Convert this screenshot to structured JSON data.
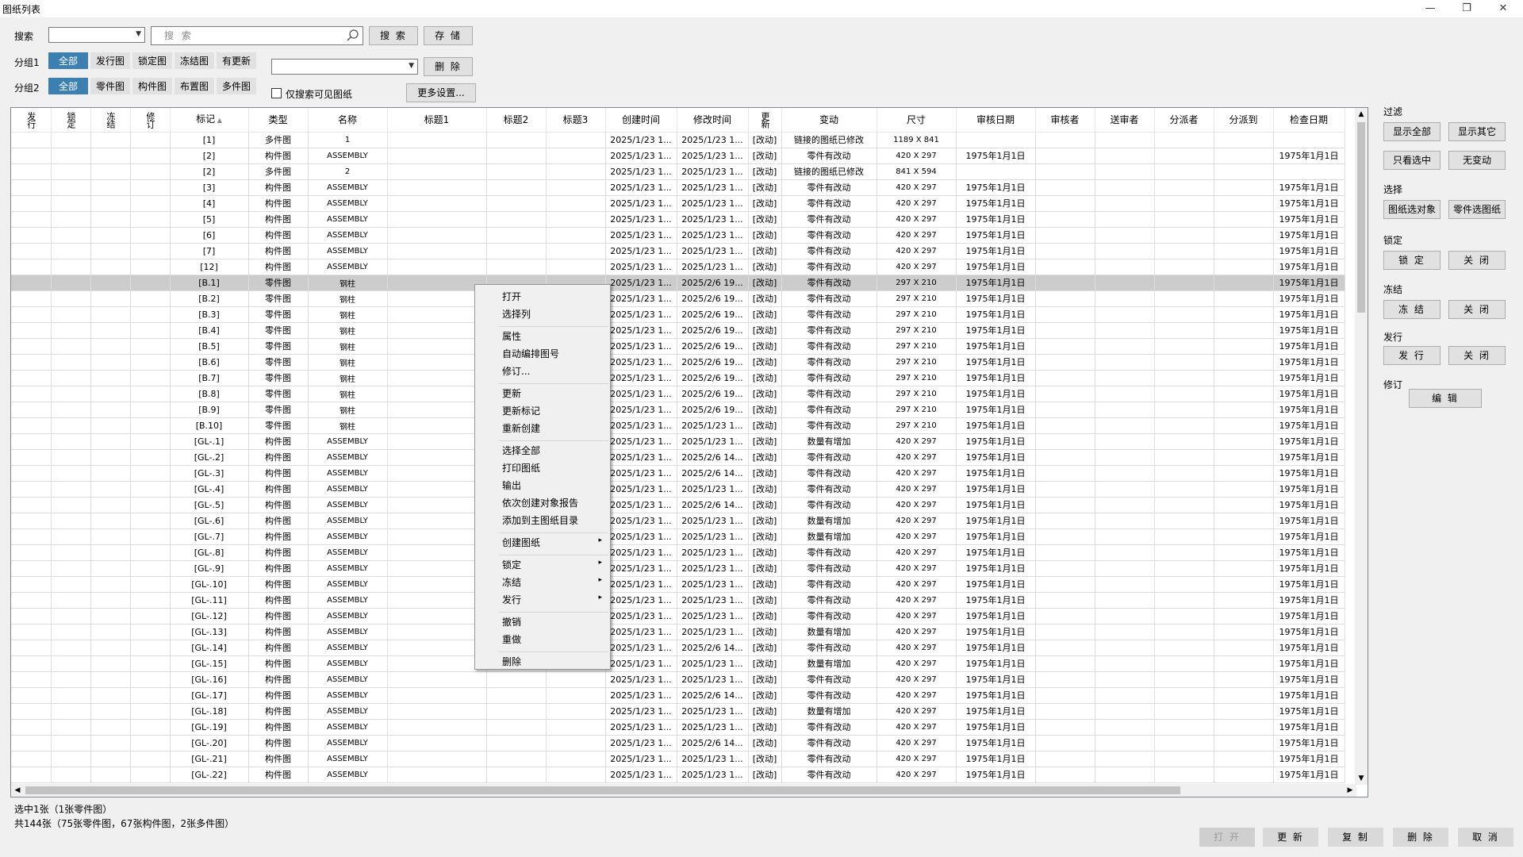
{
  "window": {
    "title": "图纸列表",
    "min": "—",
    "max": "❐",
    "close": "✕"
  },
  "toolbar": {
    "search_label": "搜索",
    "search_placeholder": "搜 索",
    "search_btn": "搜 索",
    "save_btn": "存 储",
    "group1_label": "分组1",
    "group2_label": "分组2",
    "group1": [
      "全部",
      "发行图",
      "锁定图",
      "冻结图",
      "有更新"
    ],
    "group2": [
      "全部",
      "零件图",
      "构件图",
      "布置图",
      "多件图"
    ],
    "delete_btn": "删 除",
    "only_visible": "仅搜索可见图纸",
    "more_btn": "更多设置..."
  },
  "columns": [
    "发行",
    "锁定",
    "冻结",
    "修订",
    "标记",
    "类型",
    "名称",
    "标题1",
    "标题2",
    "标题3",
    "创建时间",
    "修改时间",
    "更新",
    "变动",
    "尺寸",
    "审核日期",
    "审核者",
    "送审者",
    "分派者",
    "分派到",
    "检查日期"
  ],
  "rows": [
    [
      "[1]",
      "多件图",
      "1",
      "2025/1/23 1...",
      "2025/1/23 1...",
      "[改动]",
      "链接的图纸已修改",
      "1189 X 841",
      "",
      ""
    ],
    [
      "[2]",
      "构件图",
      "ASSEMBLY",
      "2025/1/23 1...",
      "2025/1/23 1...",
      "[改动]",
      "零件有改动",
      "420 X 297",
      "1975年1月1日",
      "1975年1月1日"
    ],
    [
      "[2]",
      "多件图",
      "2",
      "2025/1/23 1...",
      "2025/1/23 1...",
      "[改动]",
      "链接的图纸已修改",
      "841 X 594",
      "",
      ""
    ],
    [
      "[3]",
      "构件图",
      "ASSEMBLY",
      "2025/1/23 1...",
      "2025/1/23 1...",
      "[改动]",
      "零件有改动",
      "420 X 297",
      "1975年1月1日",
      "1975年1月1日"
    ],
    [
      "[4]",
      "构件图",
      "ASSEMBLY",
      "2025/1/23 1...",
      "2025/1/23 1...",
      "[改动]",
      "零件有改动",
      "420 X 297",
      "1975年1月1日",
      "1975年1月1日"
    ],
    [
      "[5]",
      "构件图",
      "ASSEMBLY",
      "2025/1/23 1...",
      "2025/1/23 1...",
      "[改动]",
      "零件有改动",
      "420 X 297",
      "1975年1月1日",
      "1975年1月1日"
    ],
    [
      "[6]",
      "构件图",
      "ASSEMBLY",
      "2025/1/23 1...",
      "2025/1/23 1...",
      "[改动]",
      "零件有改动",
      "420 X 297",
      "1975年1月1日",
      "1975年1月1日"
    ],
    [
      "[7]",
      "构件图",
      "ASSEMBLY",
      "2025/1/23 1...",
      "2025/1/23 1...",
      "[改动]",
      "零件有改动",
      "420 X 297",
      "1975年1月1日",
      "1975年1月1日"
    ],
    [
      "[12]",
      "构件图",
      "ASSEMBLY",
      "2025/1/23 1...",
      "2025/1/23 1...",
      "[改动]",
      "零件有改动",
      "420 X 297",
      "1975年1月1日",
      "1975年1月1日"
    ],
    [
      "[B.1]",
      "零件图",
      "钢柱",
      "2025/1/23 1...",
      "2025/2/6 19...",
      "[改动]",
      "零件有改动",
      "297 X 210",
      "1975年1月1日",
      "1975年1月1日"
    ],
    [
      "[B.2]",
      "零件图",
      "钢柱",
      "2025/1/23 1...",
      "2025/2/6 19...",
      "[改动]",
      "零件有改动",
      "297 X 210",
      "1975年1月1日",
      "1975年1月1日"
    ],
    [
      "[B.3]",
      "零件图",
      "钢柱",
      "2025/1/23 1...",
      "2025/2/6 19...",
      "[改动]",
      "零件有改动",
      "297 X 210",
      "1975年1月1日",
      "1975年1月1日"
    ],
    [
      "[B.4]",
      "零件图",
      "钢柱",
      "2025/1/23 1...",
      "2025/2/6 19...",
      "[改动]",
      "零件有改动",
      "297 X 210",
      "1975年1月1日",
      "1975年1月1日"
    ],
    [
      "[B.5]",
      "零件图",
      "钢柱",
      "2025/1/23 1...",
      "2025/2/6 19...",
      "[改动]",
      "零件有改动",
      "297 X 210",
      "1975年1月1日",
      "1975年1月1日"
    ],
    [
      "[B.6]",
      "零件图",
      "钢柱",
      "2025/1/23 1...",
      "2025/2/6 19...",
      "[改动]",
      "零件有改动",
      "297 X 210",
      "1975年1月1日",
      "1975年1月1日"
    ],
    [
      "[B.7]",
      "零件图",
      "钢柱",
      "2025/1/23 1...",
      "2025/2/6 19...",
      "[改动]",
      "零件有改动",
      "297 X 210",
      "1975年1月1日",
      "1975年1月1日"
    ],
    [
      "[B.8]",
      "零件图",
      "钢柱",
      "2025/1/23 1...",
      "2025/2/6 19...",
      "[改动]",
      "零件有改动",
      "297 X 210",
      "1975年1月1日",
      "1975年1月1日"
    ],
    [
      "[B.9]",
      "零件图",
      "钢柱",
      "2025/1/23 1...",
      "2025/2/6 19...",
      "[改动]",
      "零件有改动",
      "297 X 210",
      "1975年1月1日",
      "1975年1月1日"
    ],
    [
      "[B.10]",
      "零件图",
      "钢柱",
      "2025/1/23 1...",
      "2025/1/23 1...",
      "[改动]",
      "零件有改动",
      "297 X 210",
      "1975年1月1日",
      "1975年1月1日"
    ],
    [
      "[GL-.1]",
      "构件图",
      "ASSEMBLY",
      "2025/1/23 1...",
      "2025/1/23 1...",
      "[改动]",
      "数量有增加",
      "420 X 297",
      "1975年1月1日",
      "1975年1月1日"
    ],
    [
      "[GL-.2]",
      "构件图",
      "ASSEMBLY",
      "2025/1/23 1...",
      "2025/2/6 14...",
      "[改动]",
      "零件有改动",
      "420 X 297",
      "1975年1月1日",
      "1975年1月1日"
    ],
    [
      "[GL-.3]",
      "构件图",
      "ASSEMBLY",
      "2025/1/23 1...",
      "2025/2/6 14...",
      "[改动]",
      "零件有改动",
      "420 X 297",
      "1975年1月1日",
      "1975年1月1日"
    ],
    [
      "[GL-.4]",
      "构件图",
      "ASSEMBLY",
      "2025/1/23 1...",
      "2025/1/23 1...",
      "[改动]",
      "零件有改动",
      "420 X 297",
      "1975年1月1日",
      "1975年1月1日"
    ],
    [
      "[GL-.5]",
      "构件图",
      "ASSEMBLY",
      "2025/1/23 1...",
      "2025/2/6 14...",
      "[改动]",
      "零件有改动",
      "420 X 297",
      "1975年1月1日",
      "1975年1月1日"
    ],
    [
      "[GL-.6]",
      "构件图",
      "ASSEMBLY",
      "2025/1/23 1...",
      "2025/1/23 1...",
      "[改动]",
      "数量有增加",
      "420 X 297",
      "1975年1月1日",
      "1975年1月1日"
    ],
    [
      "[GL-.7]",
      "构件图",
      "ASSEMBLY",
      "2025/1/23 1...",
      "2025/1/23 1...",
      "[改动]",
      "数量有增加",
      "420 X 297",
      "1975年1月1日",
      "1975年1月1日"
    ],
    [
      "[GL-.8]",
      "构件图",
      "ASSEMBLY",
      "2025/1/23 1...",
      "2025/1/23 1...",
      "[改动]",
      "零件有改动",
      "420 X 297",
      "1975年1月1日",
      "1975年1月1日"
    ],
    [
      "[GL-.9]",
      "构件图",
      "ASSEMBLY",
      "2025/1/23 1...",
      "2025/1/23 1...",
      "[改动]",
      "零件有改动",
      "420 X 297",
      "1975年1月1日",
      "1975年1月1日"
    ],
    [
      "[GL-.10]",
      "构件图",
      "ASSEMBLY",
      "2025/1/23 1...",
      "2025/1/23 1...",
      "[改动]",
      "零件有改动",
      "420 X 297",
      "1975年1月1日",
      "1975年1月1日"
    ],
    [
      "[GL-.11]",
      "构件图",
      "ASSEMBLY",
      "2025/1/23 1...",
      "2025/1/23 1...",
      "[改动]",
      "零件有改动",
      "420 X 297",
      "1975年1月1日",
      "1975年1月1日"
    ],
    [
      "[GL-.12]",
      "构件图",
      "ASSEMBLY",
      "2025/1/23 1...",
      "2025/1/23 1...",
      "[改动]",
      "零件有改动",
      "420 X 297",
      "1975年1月1日",
      "1975年1月1日"
    ],
    [
      "[GL-.13]",
      "构件图",
      "ASSEMBLY",
      "2025/1/23 1...",
      "2025/1/23 1...",
      "[改动]",
      "数量有增加",
      "420 X 297",
      "1975年1月1日",
      "1975年1月1日"
    ],
    [
      "[GL-.14]",
      "构件图",
      "ASSEMBLY",
      "2025/1/23 1...",
      "2025/2/6 14...",
      "[改动]",
      "零件有改动",
      "420 X 297",
      "1975年1月1日",
      "1975年1月1日"
    ],
    [
      "[GL-.15]",
      "构件图",
      "ASSEMBLY",
      "2025/1/23 1...",
      "2025/1/23 1...",
      "[改动]",
      "数量有增加",
      "420 X 297",
      "1975年1月1日",
      "1975年1月1日"
    ],
    [
      "[GL-.16]",
      "构件图",
      "ASSEMBLY",
      "2025/1/23 1...",
      "2025/1/23 1...",
      "[改动]",
      "零件有改动",
      "420 X 297",
      "1975年1月1日",
      "1975年1月1日"
    ],
    [
      "[GL-.17]",
      "构件图",
      "ASSEMBLY",
      "2025/1/23 1...",
      "2025/2/6 14...",
      "[改动]",
      "零件有改动",
      "420 X 297",
      "1975年1月1日",
      "1975年1月1日"
    ],
    [
      "[GL-.18]",
      "构件图",
      "ASSEMBLY",
      "2025/1/23 1...",
      "2025/1/23 1...",
      "[改动]",
      "数量有增加",
      "420 X 297",
      "1975年1月1日",
      "1975年1月1日"
    ],
    [
      "[GL-.19]",
      "构件图",
      "ASSEMBLY",
      "2025/1/23 1...",
      "2025/1/23 1...",
      "[改动]",
      "零件有改动",
      "420 X 297",
      "1975年1月1日",
      "1975年1月1日"
    ],
    [
      "[GL-.20]",
      "构件图",
      "ASSEMBLY",
      "2025/1/23 1...",
      "2025/2/6 14...",
      "[改动]",
      "零件有改动",
      "420 X 297",
      "1975年1月1日",
      "1975年1月1日"
    ],
    [
      "[GL-.21]",
      "构件图",
      "ASSEMBLY",
      "2025/1/23 1...",
      "2025/1/23 1...",
      "[改动]",
      "零件有改动",
      "420 X 297",
      "1975年1月1日",
      "1975年1月1日"
    ],
    [
      "[GL-.22]",
      "构件图",
      "ASSEMBLY",
      "2025/1/23 1...",
      "2025/1/23 1...",
      "[改动]",
      "零件有改动",
      "420 X 297",
      "1975年1月1日",
      "1975年1月1日"
    ]
  ],
  "selected_row": 9,
  "context_menu": {
    "items": [
      "打开",
      "选择列",
      "属性",
      "自动编排图号",
      "修订...",
      "更新",
      "更新标记",
      "重新创建",
      "选择全部",
      "打印图纸",
      "输出",
      "依次创建对象报告",
      "添加到主图纸目录",
      "创建图纸",
      "锁定",
      "冻结",
      "发行",
      "撤销",
      "重做",
      "删除"
    ],
    "submenu_arrow": "▸"
  },
  "panel": {
    "filter_label": "过滤",
    "show_all": "显示全部",
    "show_other": "显示其它",
    "only_selected": "只看选中",
    "no_change": "无变动",
    "select_label": "选择",
    "drawing_select_obj": "图纸选对象",
    "part_select_drawing": "零件选图纸",
    "lock_label": "锁定",
    "lock_btn": "锁 定",
    "lock_close": "关 闭",
    "freeze_label": "冻结",
    "freeze_btn": "冻 结",
    "freeze_close": "关 闭",
    "issue_label": "发行",
    "issue_btn": "发 行",
    "issue_close": "关 闭",
    "revise_label": "修订",
    "edit_btn": "编 辑"
  },
  "status": {
    "selected": "选中1张（1张零件图）",
    "total": "共144张（75张零件图，67张构件图，2张多件图）"
  },
  "bottom": {
    "open": "打 开",
    "update": "更 新",
    "copy": "复 制",
    "delete": "删 除",
    "cancel": "取 消"
  }
}
